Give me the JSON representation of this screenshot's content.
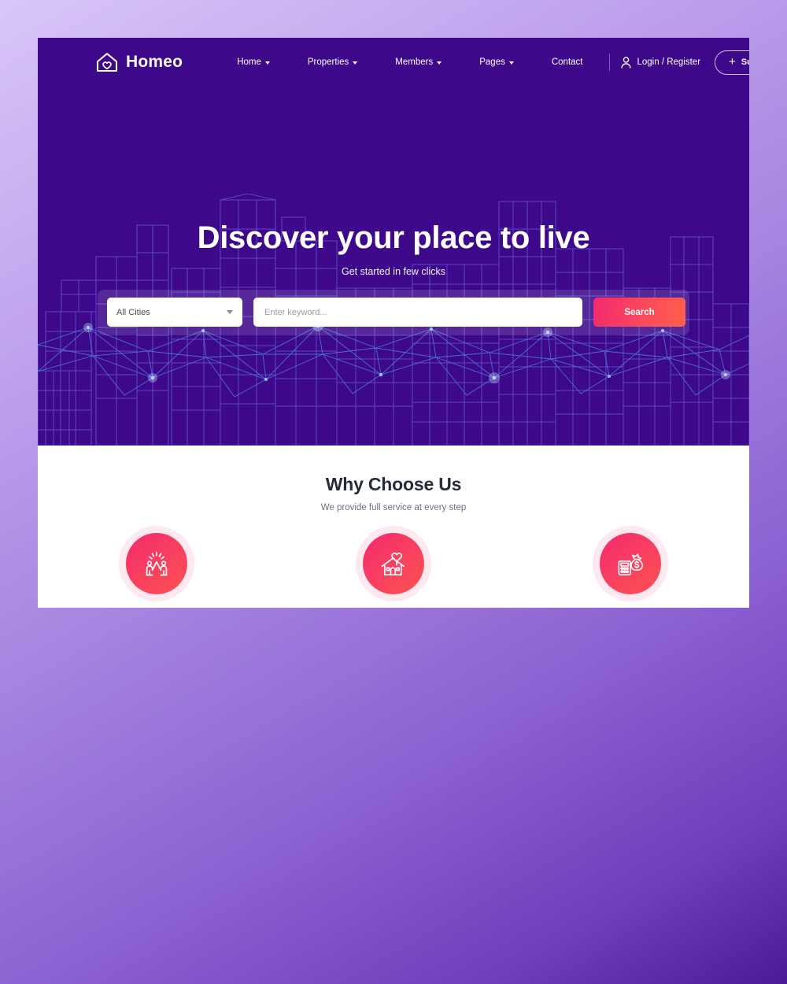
{
  "theme": {
    "hero_bg": "#3d088a",
    "accent_start": "#f32a6e",
    "accent_end": "#ff604a",
    "page_bg_start": "#d8c6f8",
    "page_bg_end": "#4a1b95",
    "card_bg": "#ffffff"
  },
  "header": {
    "brand_name": "Homeo",
    "brand_icon": "house-heart-icon",
    "nav": [
      {
        "label": "Home",
        "has_caret": true
      },
      {
        "label": "Properties",
        "has_caret": true
      },
      {
        "label": "Members",
        "has_caret": true
      },
      {
        "label": "Pages",
        "has_caret": true
      },
      {
        "label": "Contact",
        "has_caret": false
      }
    ],
    "login_label": "Login / Register",
    "login_icon": "person-icon",
    "submit_label": "Submit Property",
    "submit_icon": "plus-icon"
  },
  "hero": {
    "title": "Discover your place to live",
    "subtitle": "Get started in few clicks"
  },
  "search": {
    "city_selected": "All Cities",
    "keyword_placeholder": "Enter keyword...",
    "keyword_value": "",
    "button_label": "Search"
  },
  "why": {
    "title": "Why Choose Us",
    "subtitle": "We provide full service at every step",
    "features": [
      {
        "icon": "high-five-people-icon"
      },
      {
        "icon": "house-with-heart-icon"
      },
      {
        "icon": "calculator-money-bag-icon"
      }
    ]
  }
}
